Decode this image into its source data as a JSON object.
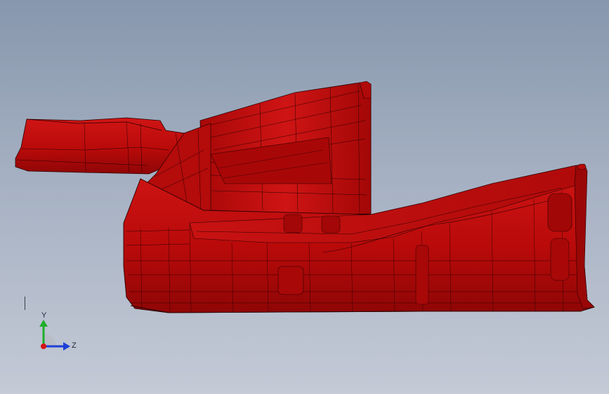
{
  "viewport": {
    "background_top": "#8797ad",
    "background_bottom": "#c4cad6"
  },
  "model": {
    "body_color": "#c10b0b",
    "body_shadow": "#8a0606",
    "body_highlight": "#e02424",
    "edge_color": "#2a0000"
  },
  "triad": {
    "y_label": "Y",
    "z_label": "Z",
    "y_color": "#1fae2a",
    "z_color": "#1d3fd6",
    "x_color": "#d41414"
  }
}
